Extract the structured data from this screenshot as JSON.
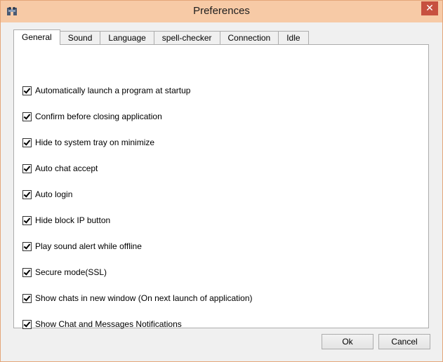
{
  "window": {
    "title": "Preferences",
    "close_label": "✕"
  },
  "tabs": [
    {
      "label": "General",
      "active": true
    },
    {
      "label": "Sound",
      "active": false
    },
    {
      "label": "Language",
      "active": false
    },
    {
      "label": "spell-checker",
      "active": false
    },
    {
      "label": "Connection",
      "active": false
    },
    {
      "label": "Idle",
      "active": false
    }
  ],
  "general": {
    "options": [
      {
        "label": "Automatically launch a program at startup",
        "checked": true
      },
      {
        "label": "Confirm before closing application",
        "checked": true
      },
      {
        "label": "Hide to system tray on minimize",
        "checked": true
      },
      {
        "label": "Auto chat accept",
        "checked": true
      },
      {
        "label": "Auto login",
        "checked": true
      },
      {
        "label": "Hide block IP button",
        "checked": true
      },
      {
        "label": "Play sound alert while offline",
        "checked": true
      },
      {
        "label": "Secure mode(SSL)",
        "checked": true
      },
      {
        "label": "Show chats in new window (On next launch of application)",
        "checked": true
      },
      {
        "label": "Show Chat and Messages Notifications",
        "checked": true
      }
    ]
  },
  "buttons": {
    "ok": "Ok",
    "cancel": "Cancel"
  }
}
